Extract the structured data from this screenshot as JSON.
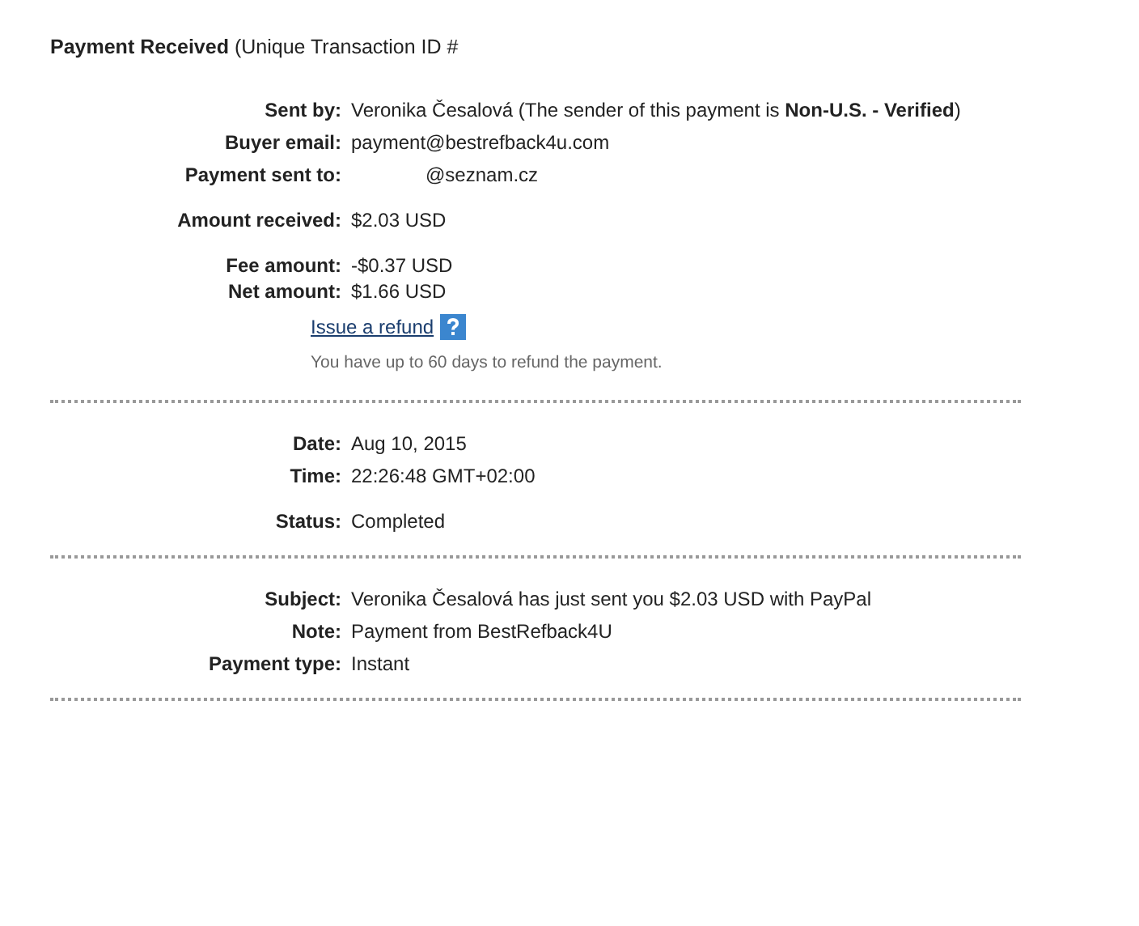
{
  "title": "**Payment Received** (Unique Transaction ID #",
  "sections": [
    {
      "groups": [
        [
          {
            "label": "Sent by:",
            "value": "Veronika Česalová (The sender of this payment is **Non-U.S. - Verified**)"
          },
          {
            "label": "Buyer email:",
            "value": "payment@bestrefback4u.com"
          },
          {
            "label": "Payment sent to:",
            "value": "@seznam.cz",
            "kind": "redacted"
          }
        ],
        [
          {
            "label": "Amount received:",
            "value": "$2.03 USD"
          }
        ],
        [
          {
            "label": "Fee amount:",
            "value": "-$0.37 USD"
          },
          {
            "label": "Net amount:",
            "value": "$1.66 USD"
          }
        ]
      ],
      "link": "Issue a refund",
      "hint": "You have up to 60 days to refund the payment."
    },
    {
      "groups": [
        [
          {
            "label": "Date:",
            "value": "Aug 10, 2015"
          },
          {
            "label": "Time:",
            "value": "22:26:48 GMT+02:00"
          }
        ],
        [
          {
            "label": "Status:",
            "value": "Completed"
          }
        ]
      ]
    },
    {
      "groups": [
        [
          {
            "label": "Subject:",
            "value": "Veronika Česalová has just sent you $2.03 USD with PayPal"
          },
          {
            "label": "Note:",
            "value": "Payment from BestRefback4U"
          },
          {
            "label": "Payment type:",
            "value": "Instant"
          }
        ]
      ]
    }
  ]
}
